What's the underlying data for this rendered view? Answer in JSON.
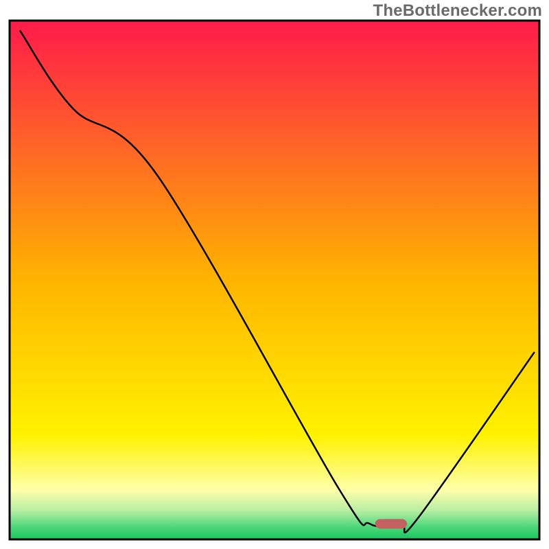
{
  "watermark": "TheBottlenecker.com",
  "chart_data": {
    "type": "line",
    "title": "",
    "xlabel": "",
    "ylabel": "",
    "xlim": [
      0,
      100
    ],
    "ylim": [
      0,
      100
    ],
    "grid": false,
    "legend": false,
    "series": [
      {
        "name": "curve",
        "x": [
          2,
          12,
          28,
          62,
          68,
          74,
          77,
          99
        ],
        "values": [
          98,
          83,
          70,
          10,
          3,
          3,
          4,
          36
        ]
      }
    ],
    "marker": {
      "name": "bottleneck-marker",
      "x_center": 72,
      "y": 3,
      "width_x": 6,
      "color": "#c46060"
    },
    "background_gradient_stops": [
      {
        "offset": 0.0,
        "color": "#ff1a4b"
      },
      {
        "offset": 0.5,
        "color": "#ffb400"
      },
      {
        "offset": 0.8,
        "color": "#fff200"
      },
      {
        "offset": 0.905,
        "color": "#ffffaa"
      },
      {
        "offset": 0.945,
        "color": "#b7eea3"
      },
      {
        "offset": 0.975,
        "color": "#4fd87b"
      },
      {
        "offset": 1.0,
        "color": "#17c65f"
      }
    ]
  }
}
